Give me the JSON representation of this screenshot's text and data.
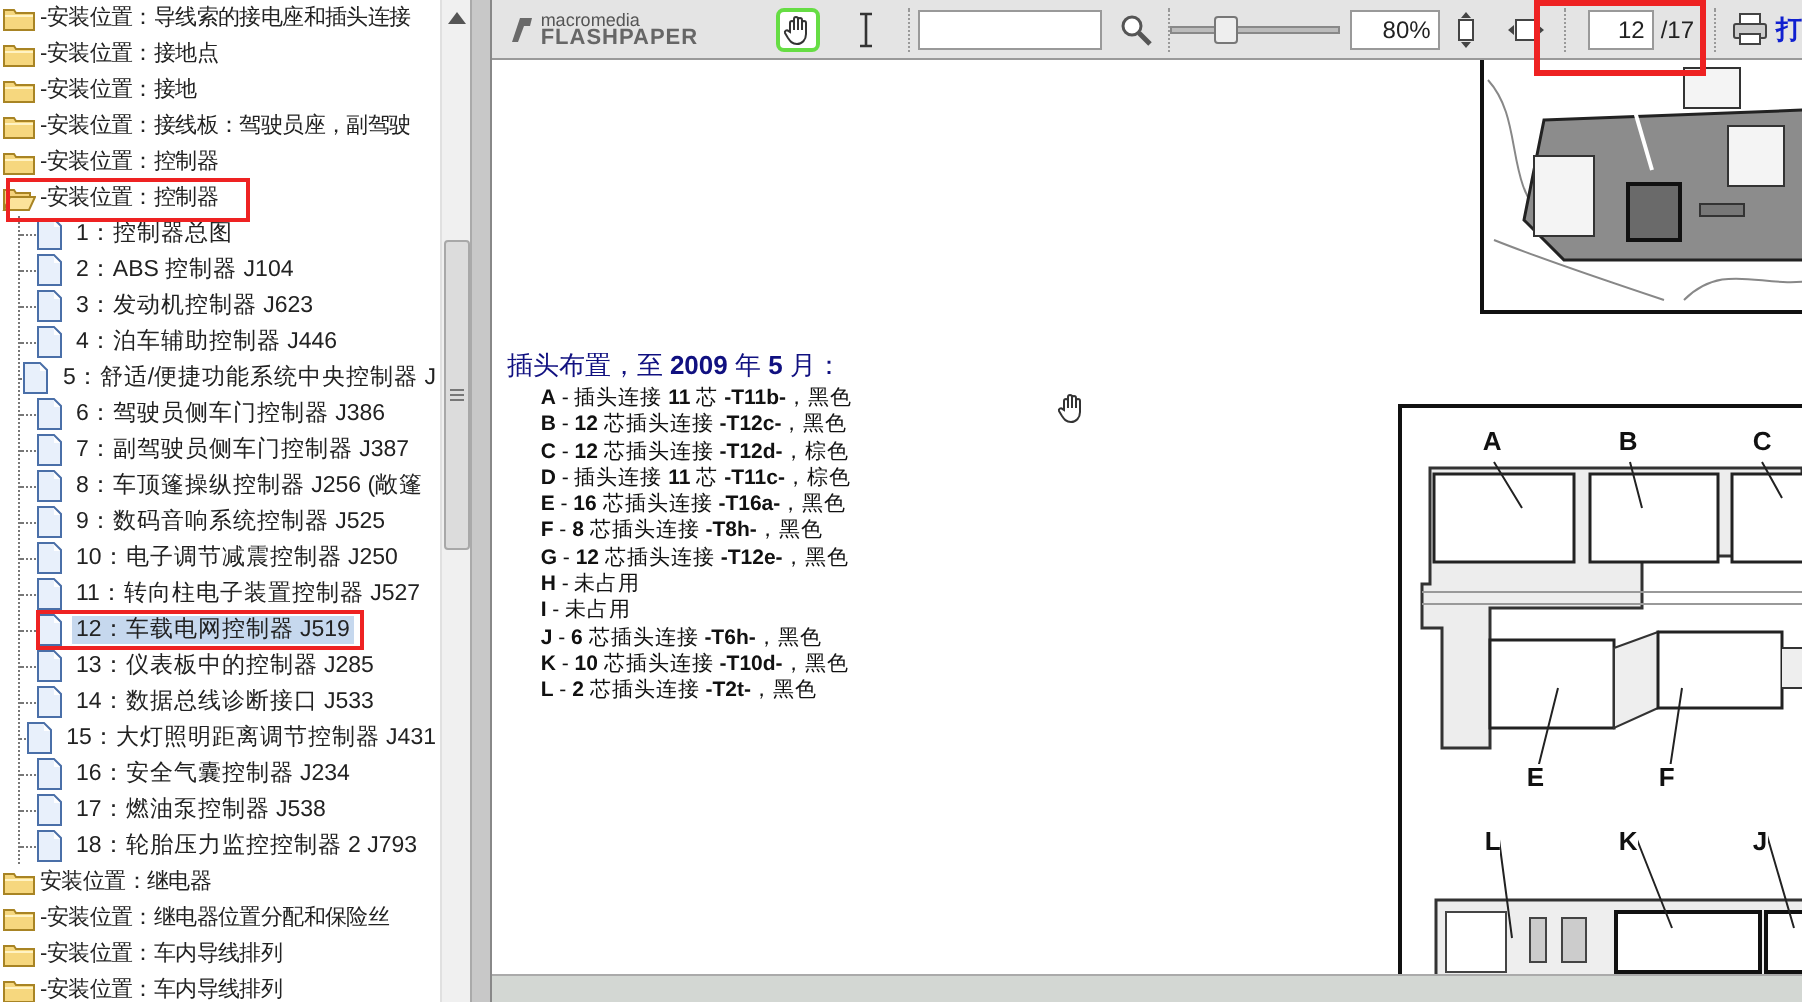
{
  "tree": {
    "items": [
      {
        "label": "-安装位置：导线索的接电座和插头连接",
        "expanded": false
      },
      {
        "label": "-安装位置：接地点",
        "expanded": false
      },
      {
        "label": "-安装位置：接地",
        "expanded": false
      },
      {
        "label": "-安装位置：接线板：驾驶员座，副驾驶",
        "expanded": false
      },
      {
        "label": "-安装位置：控制器",
        "expanded": false
      },
      {
        "label": "-安装位置：控制器",
        "expanded": true,
        "children": [
          {
            "label": "1：控制器总图",
            "selected": false
          },
          {
            "label": "2：ABS 控制器 J104",
            "selected": false
          },
          {
            "label": "3：发动机控制器 J623",
            "selected": false
          },
          {
            "label": "4：泊车辅助控制器 J446",
            "selected": false
          },
          {
            "label": "5：舒适/便捷功能系统中央控制器 J",
            "selected": false
          },
          {
            "label": "6：驾驶员侧车门控制器 J386",
            "selected": false
          },
          {
            "label": "7：副驾驶员侧车门控制器 J387",
            "selected": false
          },
          {
            "label": "8：车顶篷操纵控制器 J256 (敞篷",
            "selected": false
          },
          {
            "label": "9：数码音响系统控制器 J525",
            "selected": false
          },
          {
            "label": "10：电子调节减震控制器 J250",
            "selected": false
          },
          {
            "label": "11：转向柱电子装置控制器 J527",
            "selected": false
          },
          {
            "label": "12：车载电网控制器 J519",
            "selected": true
          },
          {
            "label": "13：仪表板中的控制器 J285",
            "selected": false
          },
          {
            "label": "14：数据总线诊断接口 J533",
            "selected": false
          },
          {
            "label": "15：大灯照明距离调节控制器 J431",
            "selected": false
          },
          {
            "label": "16：安全气囊控制器 J234",
            "selected": false
          },
          {
            "label": "17：燃油泵控制器 J538",
            "selected": false
          },
          {
            "label": "18：轮胎压力监控控制器 2 J793",
            "selected": false
          }
        ]
      },
      {
        "label": "安装位置：继电器",
        "expanded": false
      },
      {
        "label": "-安装位置：继电器位置分配和保险丝",
        "expanded": false
      },
      {
        "label": "-安装位置：车内导线排列",
        "expanded": false
      },
      {
        "label": "-安装位置：车内导线排列",
        "expanded": false
      }
    ]
  },
  "toolbar": {
    "logo_top": "macromedia",
    "logo_bottom": "FLASHPAPER",
    "tools": [
      {
        "kind": "hand",
        "selected": true
      },
      {
        "kind": "text-select",
        "selected": false
      }
    ],
    "zoom": {
      "level": 0.3,
      "value": "80%"
    },
    "page": {
      "value": "12",
      "total": "/17"
    },
    "print_label": "打"
  },
  "document": {
    "heading": "插头布置，至 **2009** 年 **5** 月：",
    "connectors": [
      "**A** - 插头连接 **11** 芯 **-T11b-**，黑色",
      "**B** - **12** 芯插头连接 **-T12c-**，黑色",
      "**C** - **12** 芯插头连接 **-T12d-**，棕色",
      "**D** - 插头连接 **11** 芯 **-T11c-**，棕色",
      "**E** - **16** 芯插头连接 **-T16a-**，黑色",
      "**F** - **8** 芯插头连接 **-T8h-**，黑色",
      "**G** - **12** 芯插头连接 **-T12e-**，黑色",
      "**H** - 未占用",
      "**I** - 未占用",
      "**J** - **6** 芯插头连接 **-T6h-**，黑色",
      "**K** - **10** 芯插头连接 **-T10d-**，黑色",
      "**L** - **2** 芯插头连接 **-T2t-**，黑色"
    ],
    "diagram_labels": [
      "A",
      "B",
      "C",
      "E",
      "F",
      "L",
      "K",
      "J"
    ]
  }
}
